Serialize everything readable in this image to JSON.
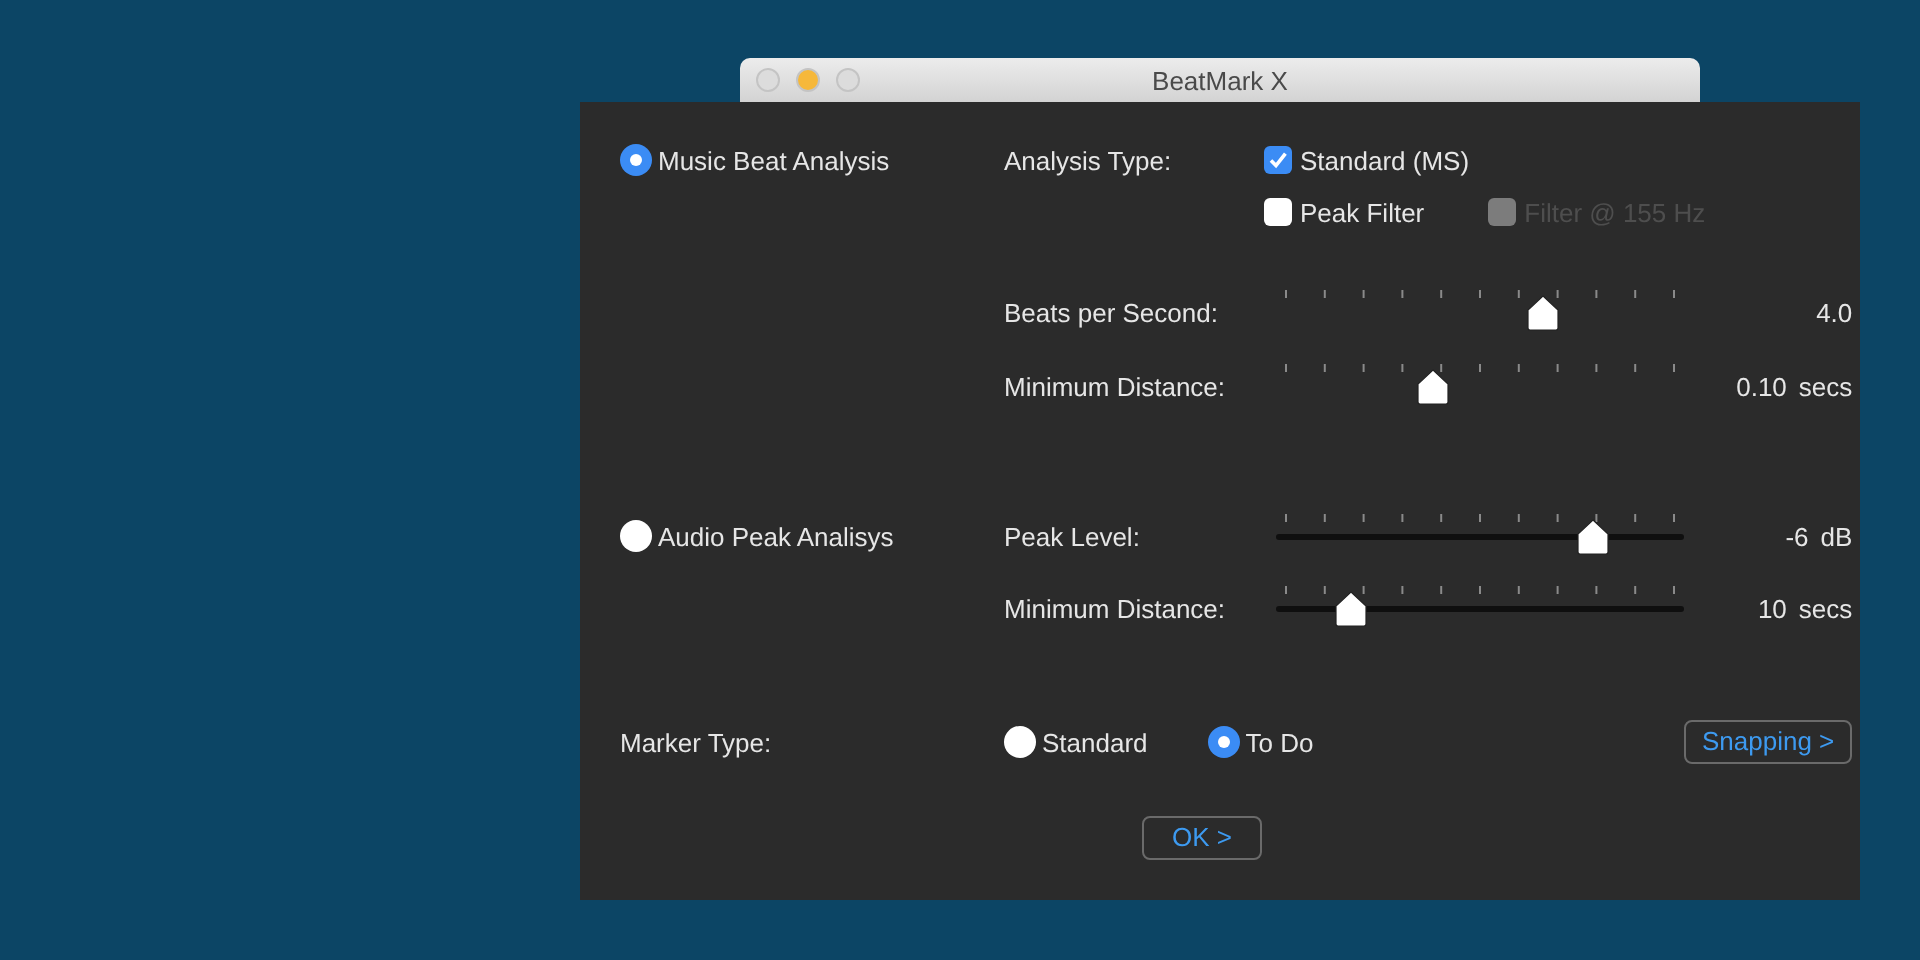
{
  "window": {
    "title": "BeatMark X"
  },
  "modes": [
    {
      "label": "Music Beat Analysis",
      "selected": true
    },
    {
      "label": "Audio Peak Analisys",
      "selected": false
    }
  ],
  "analysis_type": {
    "label": "Analysis Type:",
    "options": [
      {
        "label": "Standard (MS)",
        "checked": true,
        "disabled": false
      },
      {
        "label": "Peak Filter",
        "checked": false,
        "disabled": false
      },
      {
        "label": "Filter @ 155 Hz",
        "checked": false,
        "disabled": true
      }
    ]
  },
  "beat_sliders": [
    {
      "label": "Beats per Second:",
      "kind": "ticks",
      "level": 0.66,
      "value": "4.0"
    },
    {
      "label": "Minimum Distance:",
      "kind": "ticks",
      "level": 0.38,
      "value": "0.10",
      "unit": "secs"
    }
  ],
  "peak_sliders": [
    {
      "label": "Peak Level:",
      "kind": "track",
      "level": 0.79,
      "value": "-6",
      "unit": "dB"
    },
    {
      "label": "Minimum Distance:",
      "kind": "track",
      "level": 0.17,
      "value": "10",
      "unit": "secs"
    }
  ],
  "marker_type": {
    "label": "Marker Type:",
    "options": [
      {
        "label": "Standard",
        "selected": false
      },
      {
        "label": "To Do",
        "selected": true
      }
    ]
  },
  "snapping_button": "Snapping >",
  "ok_button": "OK >"
}
